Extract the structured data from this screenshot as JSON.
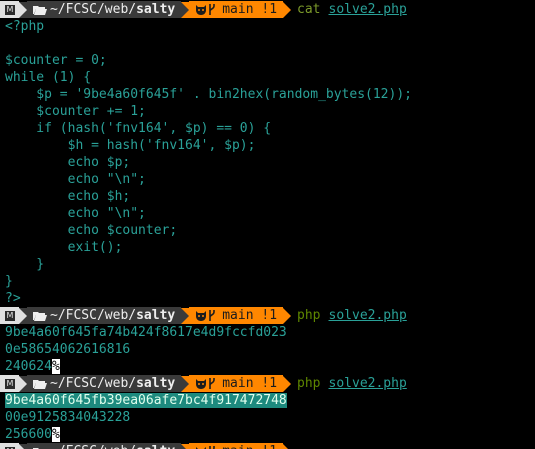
{
  "prompt": {
    "os_glyph": "M",
    "dir_prefix": "~/FCSC/web/",
    "dir_name": "salty",
    "git_branch": "main",
    "git_status": "!1"
  },
  "commands": [
    {
      "cmd": "cat",
      "arg": "solve2.php"
    },
    {
      "cmd": "php",
      "arg": "solve2.php"
    },
    {
      "cmd": "php",
      "arg": "solve2.php"
    }
  ],
  "code_lines": [
    "<?php",
    "",
    "$counter = 0;",
    "while (1) {",
    "    $p = '9be4a60f645f' . bin2hex(random_bytes(12));",
    "    $counter += 1;",
    "    if (hash('fnv164', $p) == 0) {",
    "        $h = hash('fnv164', $p);",
    "        echo $p;",
    "        echo \"\\n\";",
    "        echo $h;",
    "        echo \"\\n\";",
    "        echo $counter;",
    "        exit();",
    "    }",
    "}",
    "?>"
  ],
  "run1": {
    "line1": "9be4a60f645fa74b424f8617e4d9fccfd023",
    "line2": "0e58654062616816",
    "line3": "240624",
    "pct": "%"
  },
  "run2": {
    "line1": "9be4a60f645fb39ea06afe7bc4f917472748",
    "line2": "00e9125834043228",
    "line3": "256600",
    "pct": "%"
  },
  "colors": {
    "background": "#000000",
    "text": "#2aa198",
    "os_segment": "#e0e0e0",
    "dir_segment": "#3a3a3a",
    "git_segment": "#ff8700",
    "highlight": "#1d8a7e"
  }
}
